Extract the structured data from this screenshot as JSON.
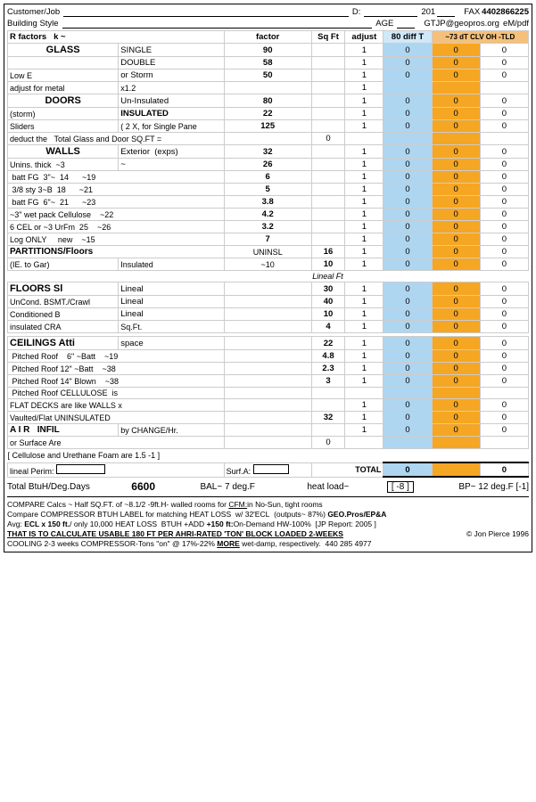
{
  "header": {
    "customer_job_label": "Customer/Job",
    "d_label": "D:",
    "year_label": "201",
    "fax_label": "FAX",
    "fax_number": "4402866225",
    "building_style_label": "Building Style",
    "age_label": "AGE",
    "gtjp_label": "GTJP@geopros.org",
    "emwpdf_label": "eM/pdf"
  },
  "column_headers": {
    "r_factors": "R factors",
    "k_label": "k ~",
    "factor": "factor",
    "sq_ft": "Sq  Ft",
    "adjust": "adjust",
    "diff_80": "80 diff T",
    "col_73": "~73 dT CLV OH -TLD"
  },
  "sections": {
    "glass": {
      "label": "GLASS",
      "rows": [
        {
          "sub": "SINGLE",
          "rfactor": "",
          "k": "",
          "factor": "90",
          "sqft": "",
          "adjust": "1",
          "v1": "0",
          "v2": "0",
          "v3": "0"
        },
        {
          "sub": "DOUBLE",
          "rfactor": "",
          "k": "",
          "factor": "58",
          "sqft": "",
          "adjust": "1",
          "v1": "0",
          "v2": "0",
          "v3": "0"
        },
        {
          "sub": "or Storm",
          "rfactor": "",
          "k": "",
          "factor": "50",
          "sqft": "",
          "adjust": "1",
          "v1": "0",
          "v2": "0",
          "v3": "0"
        },
        {
          "sub": "adjust for metal",
          "rfactor": "",
          "k": "x1.2",
          "factor": "",
          "sqft": "",
          "adjust": "1",
          "v1": "",
          "v2": "",
          "v3": ""
        }
      ],
      "low_e_label": "Low E"
    },
    "doors": {
      "label": "DOORS",
      "rows": [
        {
          "sub": "Un-Insulated",
          "rfactor": "",
          "k": "",
          "factor": "80",
          "sqft": "",
          "adjust": "1",
          "v1": "0",
          "v2": "0",
          "v3": "0"
        },
        {
          "sub": "INSULATED",
          "rfactor": "",
          "k": "",
          "factor": "22",
          "sqft": "",
          "adjust": "1",
          "v1": "0",
          "v2": "0",
          "v3": "0"
        },
        {
          "sub": "( 2 X, for Single Pane",
          "rfactor": "",
          "k": "",
          "factor": "125",
          "sqft": "",
          "adjust": "1",
          "v1": "0",
          "v2": "0",
          "v3": "0"
        }
      ],
      "storm_label": "(storm)",
      "sliders_label": "Sliders",
      "deduct_label": "deduct the",
      "total_glass_label": "Total Glass and Door SQ.FT =",
      "total_glass_value": "0"
    },
    "walls": {
      "label": "WALLS",
      "rows": [
        {
          "sub": "Exterior",
          "rfactor": "(exps)",
          "k": "",
          "factor": "32",
          "sqft": "",
          "adjust": "1",
          "v1": "0",
          "v2": "0",
          "v3": "0"
        },
        {
          "sub": "~",
          "rfactor": "~3",
          "k": "",
          "factor": "26",
          "sqft": "",
          "adjust": "1",
          "v1": "0",
          "v2": "0",
          "v3": "0"
        },
        {
          "sub": "batt FG   3\"~  14",
          "rfactor": "",
          "k": "~19",
          "factor": "6",
          "sqft": "",
          "adjust": "1",
          "v1": "0",
          "v2": "0",
          "v3": "0"
        },
        {
          "sub": "3/8 sty  3~B  18",
          "rfactor": "",
          "k": "~21",
          "factor": "5",
          "sqft": "",
          "adjust": "1",
          "v1": "0",
          "v2": "0",
          "v3": "0"
        },
        {
          "sub": "batt FG   6\"~  21",
          "rfactor": "",
          "k": "~23",
          "factor": "3.8",
          "sqft": "",
          "adjust": "1",
          "v1": "0",
          "v2": "0",
          "v3": "0"
        },
        {
          "sub": "~3\" wet pack Cellulose",
          "rfactor": "",
          "k": "~22",
          "factor": "4.2",
          "sqft": "",
          "adjust": "1",
          "v1": "0",
          "v2": "0",
          "v3": "0"
        },
        {
          "sub": "6 CEL or ~3 UrFm  25",
          "rfactor": "",
          "k": "~26",
          "factor": "3.2",
          "sqft": "",
          "adjust": "1",
          "v1": "0",
          "v2": "0",
          "v3": "0"
        },
        {
          "sub": "Log ONLY     new",
          "rfactor": "",
          "k": "~15",
          "factor": "7",
          "sqft": "",
          "adjust": "1",
          "v1": "0",
          "v2": "0",
          "v3": "0"
        }
      ],
      "unins_label": "Unins. thick"
    },
    "partitions": {
      "label": "PARTITIONS/Floors",
      "rows": [
        {
          "sub": "UNINSL",
          "rfactor": "",
          "k": "",
          "factor": "16",
          "sqft": "",
          "adjust": "1",
          "v1": "0",
          "v2": "0",
          "v3": "0"
        },
        {
          "sub": "Insulated",
          "rfactor": "~10",
          "k": "",
          "factor": "10",
          "sqft": "",
          "adjust": "1",
          "v1": "0",
          "v2": "0",
          "v3": "0"
        }
      ],
      "ie_gar_label": "(IE. to Gar)"
    },
    "floors": {
      "label": "FLOORS Sl",
      "lineal_ft_label": "Lineal Ft",
      "rows": [
        {
          "sub": "Lineal",
          "rfactor": "",
          "k": "",
          "factor": "30",
          "sqft": "",
          "adjust": "1",
          "v1": "0",
          "v2": "0",
          "v3": "0"
        },
        {
          "sub": "Lineal",
          "rfactor": "",
          "k": "",
          "factor": "40",
          "sqft": "",
          "adjust": "1",
          "v1": "0",
          "v2": "0",
          "v3": "0"
        },
        {
          "sub": "Lineal",
          "rfactor": "",
          "k": "",
          "factor": "10",
          "sqft": "",
          "adjust": "1",
          "v1": "0",
          "v2": "0",
          "v3": "0"
        },
        {
          "sub": "Sq.Ft.",
          "rfactor": "",
          "k": "",
          "factor": "4",
          "sqft": "",
          "adjust": "1",
          "v1": "0",
          "v2": "0",
          "v3": "0"
        }
      ],
      "uncond_bsmt_label": "UnCond. BSMT./Crawl",
      "conditioned_b_label": "Conditioned  B",
      "insulated_cra_label": "insulated CRA"
    },
    "ceilings": {
      "label": "CEILINGS  Atti",
      "rows": [
        {
          "sub": "space",
          "rfactor": "",
          "k": "",
          "factor": "22",
          "sqft": "",
          "adjust": "1",
          "v1": "0",
          "v2": "0",
          "v3": "0"
        },
        {
          "sub": "6\" ~Batt",
          "rfactor": "~19",
          "k": "",
          "factor": "4.8",
          "sqft": "",
          "adjust": "1",
          "v1": "0",
          "v2": "0",
          "v3": "0"
        },
        {
          "sub": "~Batt",
          "rfactor": "~38",
          "k": "",
          "factor": "2.3",
          "sqft": "",
          "adjust": "1",
          "v1": "0",
          "v2": "0",
          "v3": "0"
        },
        {
          "sub": "Blown",
          "rfactor": "~38",
          "k": "",
          "factor": "3",
          "sqft": "",
          "adjust": "1",
          "v1": "0",
          "v2": "0",
          "v3": "0"
        },
        {
          "sub": "is",
          "rfactor": "",
          "k": "",
          "factor": "",
          "sqft": "",
          "adjust": "",
          "v1": "",
          "v2": "",
          "v3": ""
        }
      ],
      "pitched_roof_label": "Pitched Roof",
      "pitched_roof12_label": "Pitched Roof 12\"",
      "pitched_roof14_label": "Pitched Roof 14\"",
      "pitched_roof_cel_label": "Pitched Roof CELLULOSE",
      "flat_decks_label": "FLAT DECKS are like WALLS",
      "flat_decks_k": "x",
      "vaulted_flat_label": "Vaulted/Flat UNINSULATED",
      "vaulted_factor": "32",
      "air_infil_label": "A I R    INFIL",
      "air_infil_sub": "by CHANGE/Hr.",
      "surface_are_label": "or Surface Are",
      "surface_are_value": "0"
    },
    "misc_rows": [
      {
        "label": "FLAT DECKS are like WALLS",
        "k": "x",
        "factor": "",
        "adjust": "1",
        "v1": "0",
        "v2": "0",
        "v3": "0"
      },
      {
        "label": "Vaulted/Flat UNINSULATED",
        "k": "",
        "factor": "32",
        "adjust": "1",
        "v1": "0",
        "v2": "0",
        "v3": "0"
      },
      {
        "label": "A I R    INFIL",
        "sub": "by CHANGE/Hr.",
        "k": "",
        "factor": "",
        "adjust": "1",
        "v1": "0",
        "v2": "0",
        "v3": "0"
      },
      {
        "label": "or Surface Are",
        "sub": "",
        "k": "",
        "factor": "",
        "adjust": "0",
        "v1": "",
        "v2": "",
        "v3": ""
      }
    ]
  },
  "cellulose_note": "[ Cellulose and Urethane Foam are 1.5 -1 ]",
  "lineal_perim_label": "lineal Perim:",
  "surf_a_label": "Surf.A:",
  "total_label": "TOTAL",
  "total_v1": "0",
  "total_v2": "0",
  "btuh_label": "Total BtuH/Deg.Days",
  "btuh_value": "6600",
  "bal_label": "BAL~ 7 deg.F",
  "heat_load_label": "heat load~",
  "heat_load_value": "-8",
  "bp_label": "BP~ 12 deg.F [-1]",
  "footer_lines": [
    "COMPARE Calcs ~ Half SQ.FT. of ~8.1/2 -9ft.H- walled rooms for CFM: in No-Sun, tight rooms",
    "Compare COMPRESSOR BTUH LABEL for matching HEAT LOSS  w/ 32'ECL  (outputs~ 87%)  GEO.Pros/EP&A",
    "Avg: ECL x 150 ft./ only 10,000 HEAT LOSS  BTUH +ADD +150 ft: On-Demand HW-100%  [JP Report: 2005 ]",
    "THAT IS TO CALCULATE USABLE 180 FT PER AHRI-RATED 'TON' BLOCK LOADED 2-WEEKS",
    "© Jon Pierce 1996",
    "COOLING 2-3 weeks COMPRESSOR-Tons \"on\" @ 17%-22% MORE wet-damp, respectively.  440 285 4977"
  ]
}
